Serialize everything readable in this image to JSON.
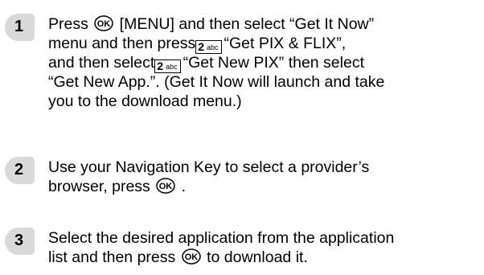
{
  "colors": {
    "badge_fill": "#d9d9d9",
    "text": "#000000"
  },
  "icons": {
    "ok_key": "ok-key-icon",
    "key_2abc": "key-2abc-icon"
  },
  "keys": {
    "ok_label": "OK",
    "two_digit": "2",
    "two_letters": "abc"
  },
  "steps": [
    {
      "number": "1",
      "l1a": "Press ",
      "l1b": " [MENU] and then select “Get It Now”",
      "l2a": "menu and then press",
      "l2b": "“Get PIX & FLIX”,",
      "l3a": "and then select",
      "l3b": "“Get New PIX” then select",
      "l4": "“Get New App.”. (Get It Now will launch and take",
      "l5": "you to the download menu.)"
    },
    {
      "number": "2",
      "l1": "Use your Navigation Key to select a provider’s",
      "l2a": "browser, press ",
      "l2b": " ."
    },
    {
      "number": "3",
      "l1": "Select the desired application from the application",
      "l2a": "list and then press ",
      "l2b": " to download it."
    }
  ]
}
